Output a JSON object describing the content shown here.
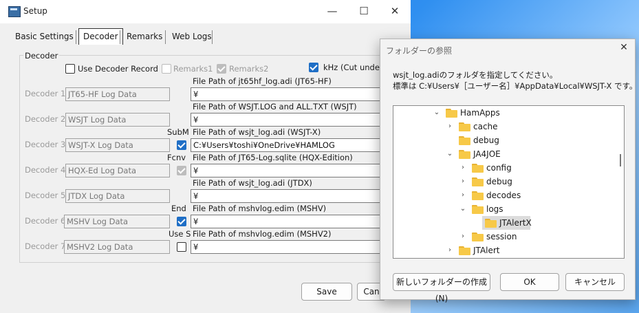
{
  "setup": {
    "title": "Setup",
    "min": "—",
    "max": "☐",
    "close": "✕",
    "tabs": [
      "Basic Settings",
      "Decoder",
      "Remarks",
      "Web Logs"
    ],
    "group_label": "Decoder",
    "use_decoder_record": "Use Decoder Record",
    "remarks1": "Remarks1",
    "remarks2": "Remarks2",
    "khz": "kHz (Cut under",
    "rows": [
      {
        "label": "Decoder 1",
        "name": "JT65-HF Log Data",
        "side": "",
        "path_label": "File Path of jt65hf_log.adi (JT65-HF)",
        "path": "¥"
      },
      {
        "label": "Decoder 2",
        "name": "WSJT Log Data",
        "side": "",
        "path_label": "File Path of WSJT.LOG and ALL.TXT (WSJT)",
        "path": "¥"
      },
      {
        "label": "Decoder 3",
        "name": "WSJT-X Log Data",
        "side": "SubM",
        "path_label": "File Path of wsjt_log.adi (WSJT-X)",
        "path": "C:¥Users¥toshi¥OneDrive¥HAMLOG"
      },
      {
        "label": "Decoder 4",
        "name": "HQX-Ed Log Data",
        "side": "Fcnv",
        "path_label": "File Path of JT65-Log.sqlite (HQX-Edition)",
        "path": "¥"
      },
      {
        "label": "Decoder 5",
        "name": "JTDX Log Data",
        "side": "",
        "path_label": "File Path of wsjt_log.adi (JTDX)",
        "path": "¥"
      },
      {
        "label": "Decoder 6",
        "name": "MSHV Log Data",
        "side": "End",
        "path_label": "File Path of mshvlog.edim (MSHV)",
        "path": "¥"
      },
      {
        "label": "Decoder 7",
        "name": "MSHV2 Log Data",
        "side": "Use S",
        "path_label": "File Path of mshvlog.edim (MSHV2)",
        "path": "¥"
      }
    ],
    "save": "Save",
    "cancel": "Can"
  },
  "dialog": {
    "title": "フォルダーの参照",
    "close": "✕",
    "desc1": "wsjt_log.adiのフォルダを指定してください。",
    "desc2": "標準は C:¥Users¥［ユーザー名］¥AppData¥Local¥WSJT-X です。",
    "tree": [
      {
        "label": "HamApps",
        "chev": "⌄"
      },
      {
        "label": "cache",
        "chev": "›"
      },
      {
        "label": "debug",
        "chev": ""
      },
      {
        "label": "JA4JOE",
        "chev": "⌄"
      },
      {
        "label": "config",
        "chev": "›"
      },
      {
        "label": "debug",
        "chev": "›"
      },
      {
        "label": "decodes",
        "chev": "›"
      },
      {
        "label": "logs",
        "chev": "⌄"
      },
      {
        "label": "JTAlertX",
        "chev": ""
      },
      {
        "label": "session",
        "chev": "›"
      },
      {
        "label": "JTAlert",
        "chev": "›"
      }
    ],
    "new_folder": "新しいフォルダーの作成(N)",
    "ok": "OK",
    "cancel": "キャンセル"
  }
}
